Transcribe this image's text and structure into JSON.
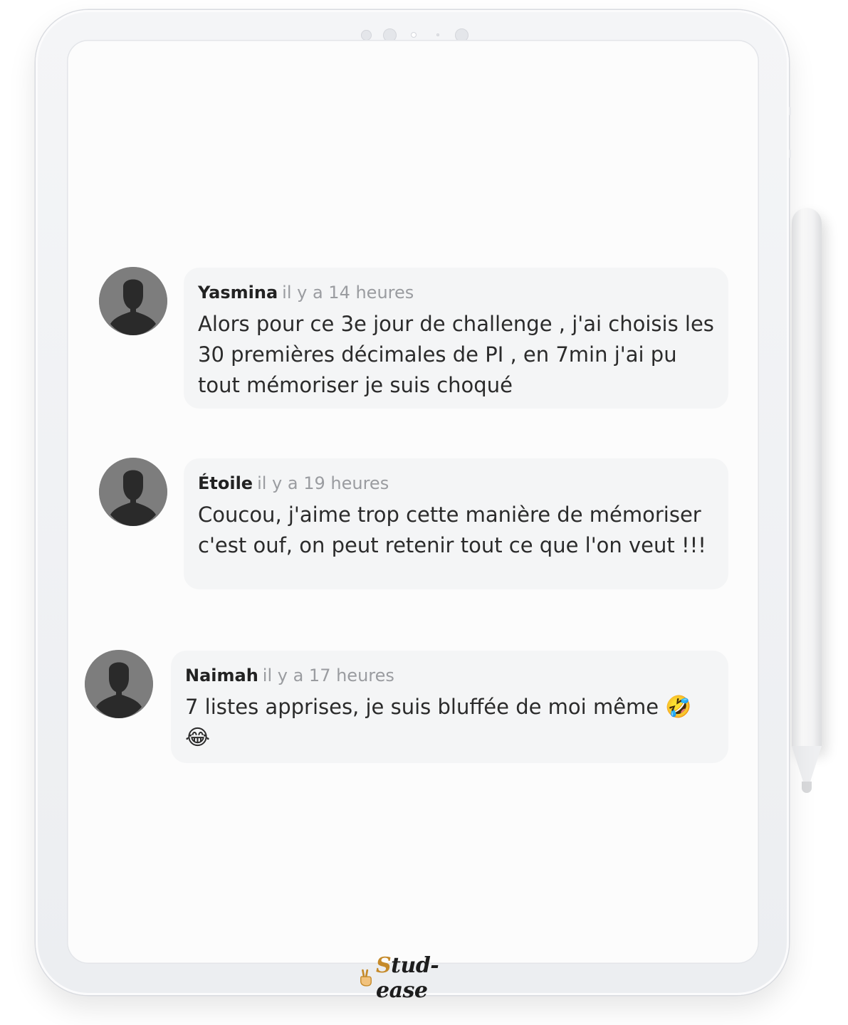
{
  "comments": [
    {
      "author": "Yasmina",
      "time": "il y a 14 heures",
      "text": "Alors pour ce 3e jour de challenge , j'ai choisis les 30 premières décimales de PI , en 7min j'ai pu tout mémoriser je suis choqué"
    },
    {
      "author": "Étoile",
      "time": "il y a 19 heures",
      "text": "Coucou, j'aime trop cette manière de mémoriser c'est ouf, on peut retenir tout ce que l'on veut !!!"
    },
    {
      "author": "Naimah",
      "time": "il y a 17 heures",
      "text": "7 listes apprises, je suis bluffée de moi même",
      "emojis": [
        "🤣",
        "😂"
      ]
    }
  ],
  "brand": {
    "logo_lead": "S",
    "logo_rest": "tud-ease",
    "icon": "peace-hand-icon"
  },
  "colors": {
    "bubble": "#f4f5f6",
    "avatar": "#7d7d7d",
    "author": "#222222",
    "time": "#9a9ca0",
    "brand_accent": "#c58a2a"
  }
}
